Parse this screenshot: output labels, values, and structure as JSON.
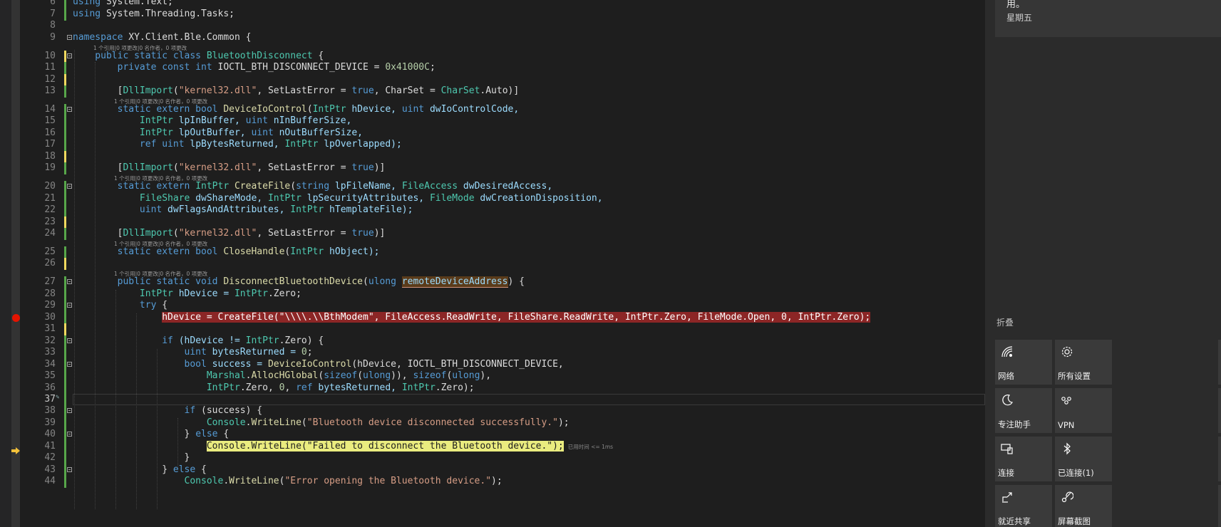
{
  "editor": {
    "lines": [
      {
        "n": "6",
        "code": [
          {
            "t": "using",
            "c": "kw"
          },
          {
            "t": " System.Text;",
            "c": ""
          }
        ]
      },
      {
        "n": "7",
        "code": [
          {
            "t": "using",
            "c": "kw"
          },
          {
            "t": " System.Threading.Tasks;",
            "c": ""
          }
        ]
      },
      {
        "n": "8",
        "code": []
      },
      {
        "n": "9",
        "code": [
          {
            "t": "namespace",
            "c": "kw"
          },
          {
            "t": " XY.Client.Ble.Common {",
            "c": ""
          }
        ]
      },
      {
        "n": "10",
        "code": [
          {
            "t": "    public static class ",
            "c": "kw"
          },
          {
            "t": "BluetoothDisconnect",
            "c": "ty"
          },
          {
            "t": " {",
            "c": ""
          }
        ]
      },
      {
        "n": "11",
        "code": [
          {
            "t": "        private const int ",
            "c": "kw"
          },
          {
            "t": "IOCTL_BTH_DISCONNECT_DEVICE = ",
            "c": ""
          },
          {
            "t": "0x41000C",
            "c": "nm"
          },
          {
            "t": ";",
            "c": ""
          }
        ]
      },
      {
        "n": "12",
        "code": []
      },
      {
        "n": "13",
        "code": [
          {
            "t": "        [",
            "c": ""
          },
          {
            "t": "DllImport",
            "c": "ty"
          },
          {
            "t": "(",
            "c": ""
          },
          {
            "t": "\"kernel32.dll\"",
            "c": "st"
          },
          {
            "t": ", SetLastError = ",
            "c": ""
          },
          {
            "t": "true",
            "c": "kw"
          },
          {
            "t": ", CharSet = ",
            "c": ""
          },
          {
            "t": "CharSet",
            "c": "ty"
          },
          {
            "t": ".Auto)]",
            "c": ""
          }
        ]
      },
      {
        "n": "14",
        "code": [
          {
            "t": "        static extern bool ",
            "c": "kw"
          },
          {
            "t": "DeviceIoControl",
            "c": "fn"
          },
          {
            "t": "(",
            "c": ""
          },
          {
            "t": "IntPtr",
            "c": "ty"
          },
          {
            "t": " hDevice, ",
            "c": "vr"
          },
          {
            "t": "uint",
            "c": "kw"
          },
          {
            "t": " dwIoControlCode,",
            "c": "vr"
          }
        ]
      },
      {
        "n": "15",
        "code": [
          {
            "t": "            IntPtr",
            "c": "ty"
          },
          {
            "t": " lpInBuffer, ",
            "c": "vr"
          },
          {
            "t": "uint",
            "c": "kw"
          },
          {
            "t": " nInBufferSize,",
            "c": "vr"
          }
        ]
      },
      {
        "n": "16",
        "code": [
          {
            "t": "            IntPtr",
            "c": "ty"
          },
          {
            "t": " lpOutBuffer, ",
            "c": "vr"
          },
          {
            "t": "uint",
            "c": "kw"
          },
          {
            "t": " nOutBufferSize,",
            "c": "vr"
          }
        ]
      },
      {
        "n": "17",
        "code": [
          {
            "t": "            ref uint",
            "c": "kw"
          },
          {
            "t": " lpBytesReturned, ",
            "c": "vr"
          },
          {
            "t": "IntPtr",
            "c": "ty"
          },
          {
            "t": " lpOverlapped);",
            "c": "vr"
          }
        ]
      },
      {
        "n": "18",
        "code": []
      },
      {
        "n": "19",
        "code": [
          {
            "t": "        [",
            "c": ""
          },
          {
            "t": "DllImport",
            "c": "ty"
          },
          {
            "t": "(",
            "c": ""
          },
          {
            "t": "\"kernel32.dll\"",
            "c": "st"
          },
          {
            "t": ", SetLastError = ",
            "c": ""
          },
          {
            "t": "true",
            "c": "kw"
          },
          {
            "t": ")]",
            "c": ""
          }
        ]
      },
      {
        "n": "20",
        "code": [
          {
            "t": "        static extern ",
            "c": "kw"
          },
          {
            "t": "IntPtr",
            "c": "ty"
          },
          {
            "t": " ",
            "c": ""
          },
          {
            "t": "CreateFile",
            "c": "fn"
          },
          {
            "t": "(",
            "c": ""
          },
          {
            "t": "string",
            "c": "kw"
          },
          {
            "t": " lpFileName, ",
            "c": "vr"
          },
          {
            "t": "FileAccess",
            "c": "ty"
          },
          {
            "t": " dwDesiredAccess,",
            "c": "vr"
          }
        ]
      },
      {
        "n": "21",
        "code": [
          {
            "t": "            FileShare",
            "c": "ty"
          },
          {
            "t": " dwShareMode, ",
            "c": "vr"
          },
          {
            "t": "IntPtr",
            "c": "ty"
          },
          {
            "t": " lpSecurityAttributes, ",
            "c": "vr"
          },
          {
            "t": "FileMode",
            "c": "ty"
          },
          {
            "t": " dwCreationDisposition,",
            "c": "vr"
          }
        ]
      },
      {
        "n": "22",
        "code": [
          {
            "t": "            uint",
            "c": "kw"
          },
          {
            "t": " dwFlagsAndAttributes, ",
            "c": "vr"
          },
          {
            "t": "IntPtr",
            "c": "ty"
          },
          {
            "t": " hTemplateFile);",
            "c": "vr"
          }
        ]
      },
      {
        "n": "23",
        "code": []
      },
      {
        "n": "24",
        "code": [
          {
            "t": "        [",
            "c": ""
          },
          {
            "t": "DllImport",
            "c": "ty"
          },
          {
            "t": "(",
            "c": ""
          },
          {
            "t": "\"kernel32.dll\"",
            "c": "st"
          },
          {
            "t": ", SetLastError = ",
            "c": ""
          },
          {
            "t": "true",
            "c": "kw"
          },
          {
            "t": ")]",
            "c": ""
          }
        ]
      },
      {
        "n": "25",
        "code": [
          {
            "t": "        static extern bool ",
            "c": "kw"
          },
          {
            "t": "CloseHandle",
            "c": "fn"
          },
          {
            "t": "(",
            "c": ""
          },
          {
            "t": "IntPtr",
            "c": "ty"
          },
          {
            "t": " hObject);",
            "c": "vr"
          }
        ]
      },
      {
        "n": "26",
        "code": []
      },
      {
        "n": "27",
        "code": [
          {
            "t": "        public static void ",
            "c": "kw"
          },
          {
            "t": "DisconnectBluetoothDevice",
            "c": "fn"
          },
          {
            "t": "(",
            "c": ""
          },
          {
            "t": "ulong",
            "c": "kw"
          },
          {
            "t": " ",
            "c": ""
          },
          {
            "t": "remoteDeviceAddress",
            "c": "vr hl-param"
          },
          {
            "t": ") {",
            "c": ""
          }
        ]
      },
      {
        "n": "28",
        "code": [
          {
            "t": "            IntPtr",
            "c": "ty"
          },
          {
            "t": " hDevice = ",
            "c": "vr"
          },
          {
            "t": "IntPtr",
            "c": "ty"
          },
          {
            "t": ".Zero;",
            "c": ""
          }
        ]
      },
      {
        "n": "29",
        "code": [
          {
            "t": "            try",
            "c": "kw"
          },
          {
            "t": " {",
            "c": ""
          }
        ]
      },
      {
        "n": "30",
        "code": [
          {
            "t": "                ",
            "c": ""
          },
          {
            "t": "hDevice = CreateFile(\"\\\\\\\\.\\\\BthModem\", FileAccess.ReadWrite, FileShare.ReadWrite, IntPtr.Zero, FileMode.Open, 0, IntPtr.Zero);",
            "c": "bp-line"
          }
        ]
      },
      {
        "n": "31",
        "code": []
      },
      {
        "n": "32",
        "code": [
          {
            "t": "                if",
            "c": "kw"
          },
          {
            "t": " (hDevice != ",
            "c": "vr"
          },
          {
            "t": "IntPtr",
            "c": "ty"
          },
          {
            "t": ".Zero) {",
            "c": ""
          }
        ]
      },
      {
        "n": "33",
        "code": [
          {
            "t": "                    uint",
            "c": "kw"
          },
          {
            "t": " bytesReturned = ",
            "c": "vr"
          },
          {
            "t": "0",
            "c": "nm"
          },
          {
            "t": ";",
            "c": ""
          }
        ]
      },
      {
        "n": "34",
        "code": [
          {
            "t": "                    bool",
            "c": "kw"
          },
          {
            "t": " success = ",
            "c": "vr"
          },
          {
            "t": "DeviceIoControl",
            "c": "fn"
          },
          {
            "t": "(hDevice, IOCTL_BTH_DISCONNECT_DEVICE,",
            "c": ""
          }
        ]
      },
      {
        "n": "35",
        "code": [
          {
            "t": "                        Marshal",
            "c": "ty"
          },
          {
            "t": ".",
            "c": ""
          },
          {
            "t": "AllocHGlobal",
            "c": "fn"
          },
          {
            "t": "(",
            "c": ""
          },
          {
            "t": "sizeof",
            "c": "kw"
          },
          {
            "t": "(",
            "c": ""
          },
          {
            "t": "ulong",
            "c": "kw"
          },
          {
            "t": ")), ",
            "c": ""
          },
          {
            "t": "sizeof",
            "c": "kw"
          },
          {
            "t": "(",
            "c": ""
          },
          {
            "t": "ulong",
            "c": "kw"
          },
          {
            "t": "),",
            "c": ""
          }
        ]
      },
      {
        "n": "36",
        "code": [
          {
            "t": "                        IntPtr",
            "c": "ty"
          },
          {
            "t": ".Zero, ",
            "c": ""
          },
          {
            "t": "0",
            "c": "nm"
          },
          {
            "t": ", ",
            "c": ""
          },
          {
            "t": "ref",
            "c": "kw"
          },
          {
            "t": " bytesReturned, ",
            "c": "vr"
          },
          {
            "t": "IntPtr",
            "c": "ty"
          },
          {
            "t": ".Zero);",
            "c": ""
          }
        ]
      },
      {
        "n": "37",
        "code": []
      },
      {
        "n": "38",
        "code": [
          {
            "t": "                    if",
            "c": "kw"
          },
          {
            "t": " (success) {",
            "c": ""
          }
        ]
      },
      {
        "n": "39",
        "code": [
          {
            "t": "                        Console",
            "c": "ty"
          },
          {
            "t": ".",
            "c": ""
          },
          {
            "t": "WriteLine",
            "c": "fn"
          },
          {
            "t": "(",
            "c": ""
          },
          {
            "t": "\"Bluetooth device disconnected successfully.\"",
            "c": "st"
          },
          {
            "t": ");",
            "c": ""
          }
        ]
      },
      {
        "n": "40",
        "code": [
          {
            "t": "                    } ",
            "c": ""
          },
          {
            "t": "else",
            "c": "kw"
          },
          {
            "t": " {",
            "c": ""
          }
        ]
      },
      {
        "n": "41",
        "code": [
          {
            "t": "                        ",
            "c": ""
          },
          {
            "t": "Console.WriteLine(\"Failed to disconnect the Bluetooth device.\");",
            "c": "cur-stmt"
          }
        ]
      },
      {
        "n": "42",
        "code": [
          {
            "t": "                    }",
            "c": ""
          }
        ]
      },
      {
        "n": "43",
        "code": [
          {
            "t": "                } ",
            "c": ""
          },
          {
            "t": "else",
            "c": "kw"
          },
          {
            "t": " {",
            "c": ""
          }
        ]
      },
      {
        "n": "44",
        "code": [
          {
            "t": "                    Console",
            "c": "ty"
          },
          {
            "t": ".",
            "c": ""
          },
          {
            "t": "WriteLine",
            "c": "fn"
          },
          {
            "t": "(",
            "c": ""
          },
          {
            "t": "\"Error opening the Bluetooth device.\"",
            "c": "st"
          },
          {
            "t": ");",
            "c": ""
          }
        ]
      }
    ],
    "codelens": {
      "class": "1 个引用|0 项更改|0 名作者，0 项更改",
      "methods": "1 个引用|0 项更改|0 名作者，0 项更改",
      "deviceio": "1 个引用|0 项更改|0 名作者，0 项更改",
      "disconnect": "1 个引用|0 项更改|0 名作者，0 项更改"
    },
    "elapsed_hint": "已用时间 <= 1ms",
    "active_line": "37",
    "breakpoint_line": "30",
    "current_line": "41"
  },
  "action_center": {
    "notification": {
      "text": "用。",
      "day": "星期五"
    },
    "collapse_label": "折叠",
    "tiles": [
      {
        "label": "网络",
        "icon": "network-icon"
      },
      {
        "label": "所有设置",
        "icon": "gear-icon"
      },
      {
        "label": "专注助手",
        "icon": "moon-icon"
      },
      {
        "label": "VPN",
        "icon": "vpn-icon"
      },
      {
        "label": "连接",
        "icon": "connect-icon"
      },
      {
        "label": "已连接(1)",
        "icon": "bluetooth-icon"
      },
      {
        "label": "就近共享",
        "icon": "share-icon"
      },
      {
        "label": "屏幕截图",
        "icon": "snip-icon"
      }
    ]
  }
}
